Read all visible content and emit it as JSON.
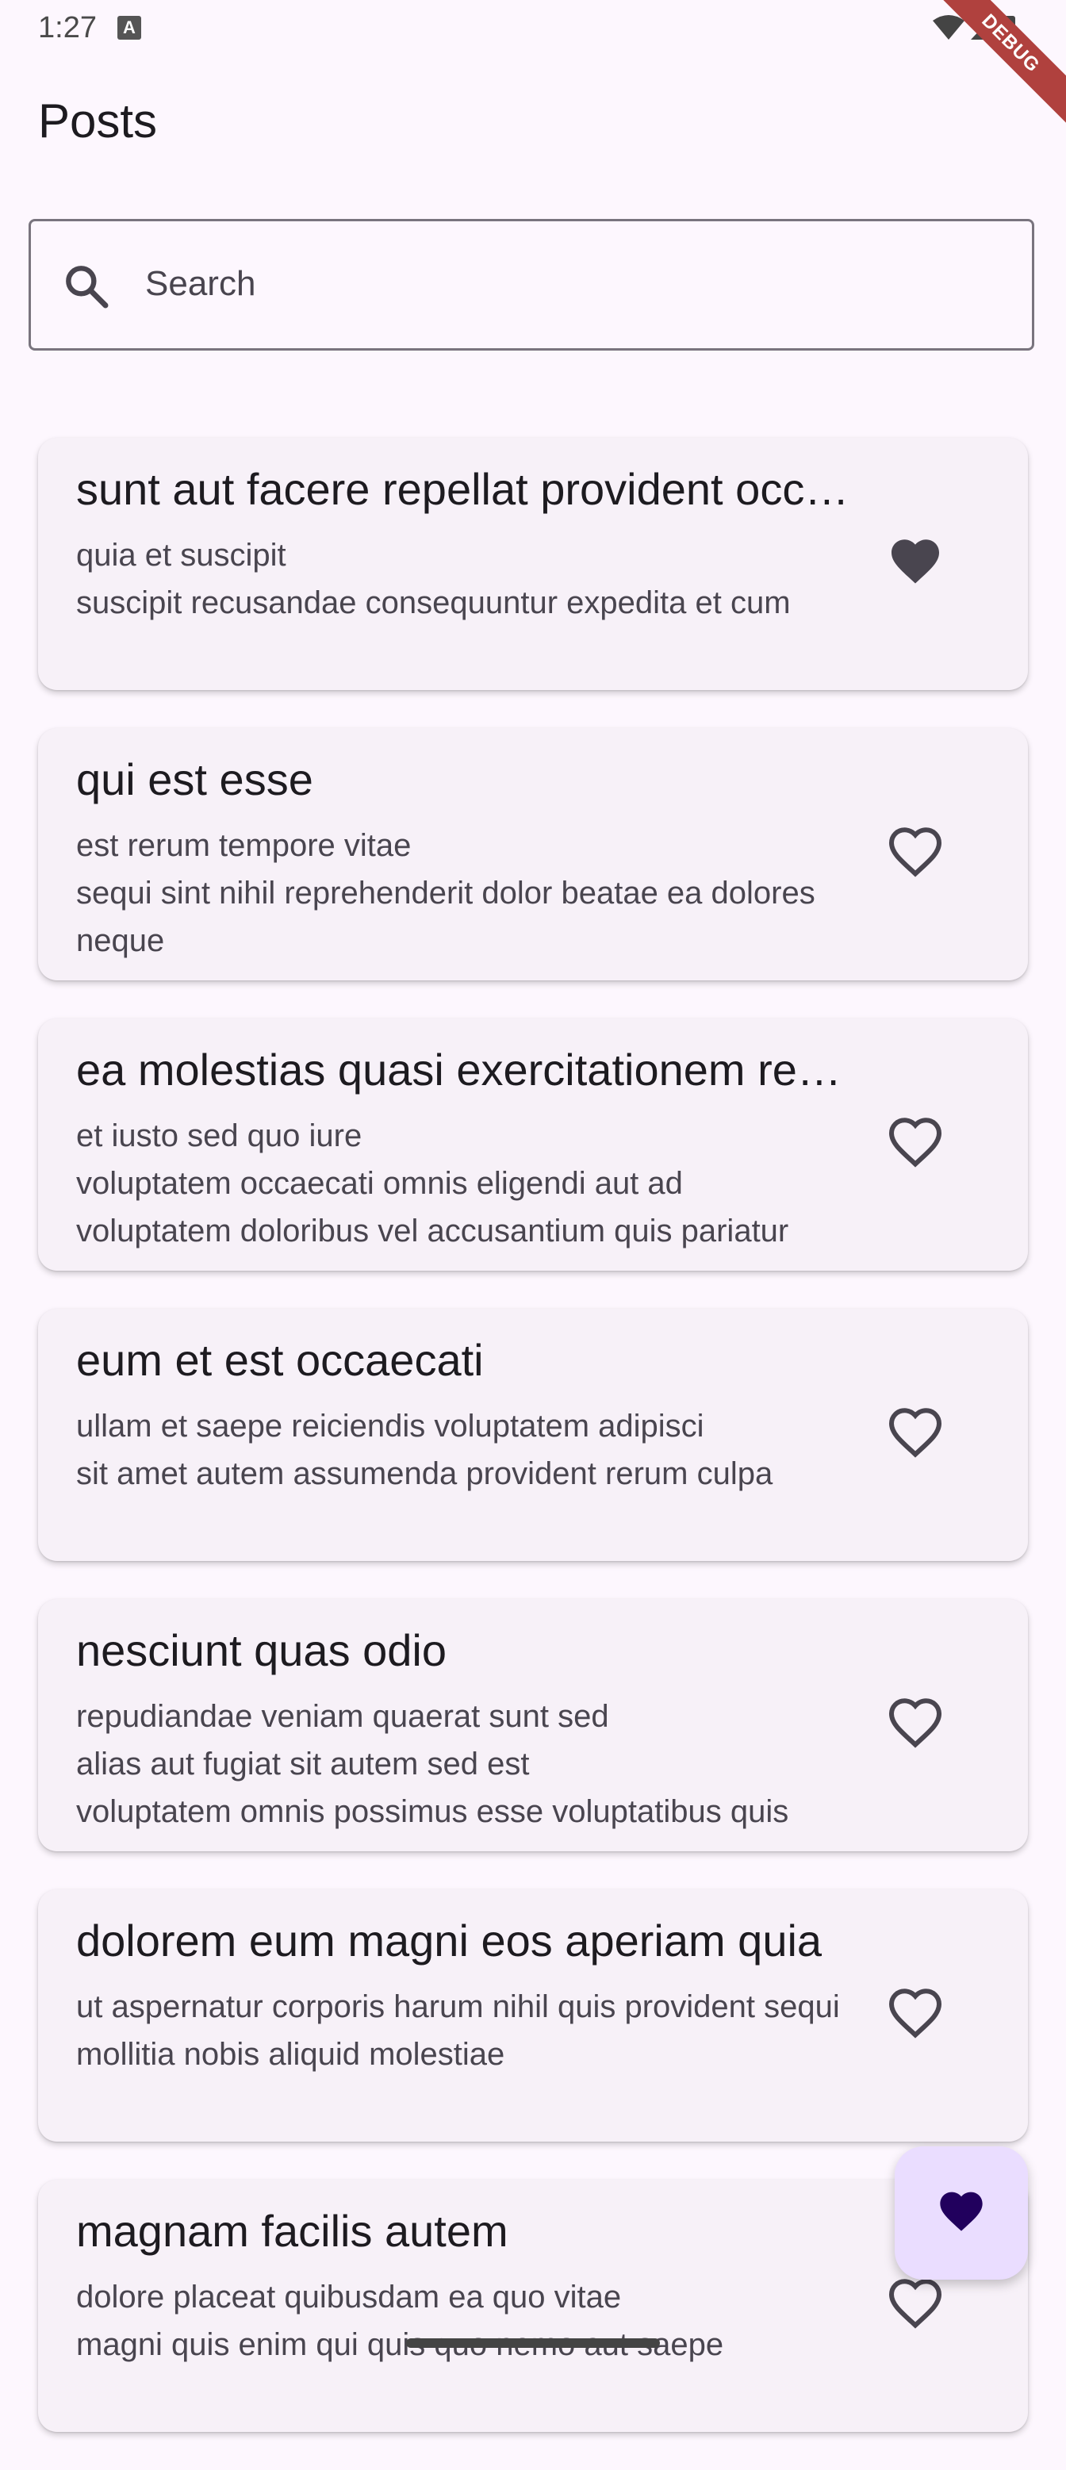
{
  "status_bar": {
    "time": "1:27",
    "notification_letter": "A"
  },
  "debug_banner": {
    "label": "DEBUG"
  },
  "app_bar": {
    "title": "Posts"
  },
  "search": {
    "placeholder": "Search",
    "icon": "search-icon"
  },
  "posts": [
    {
      "title": "sunt aut facere repellat provident occaecati excepturi optio reprehenderit",
      "body": "quia et suscipit\nsuscipit recusandae consequuntur expedita et cum",
      "favorite": true
    },
    {
      "title": "qui est esse",
      "body": "est rerum tempore vitae\nsequi sint nihil reprehenderit dolor beatae ea dolores neque",
      "favorite": false
    },
    {
      "title": "ea molestias quasi exercitationem repellat qui ipsa sit aut",
      "body": "et iusto sed quo iure\nvoluptatem occaecati omnis eligendi aut ad\nvoluptatem doloribus vel accusantium quis pariatur",
      "favorite": false
    },
    {
      "title": "eum et est occaecati",
      "body": "ullam et saepe reiciendis voluptatem adipisci\nsit amet autem assumenda provident rerum culpa",
      "favorite": false
    },
    {
      "title": "nesciunt quas odio",
      "body": "repudiandae veniam quaerat sunt sed\nalias aut fugiat sit autem sed est\nvoluptatem omnis possimus esse voluptatibus quis",
      "favorite": false
    },
    {
      "title": "dolorem eum magni eos aperiam quia",
      "body": "ut aspernatur corporis harum nihil quis provident sequi\nmollitia nobis aliquid molestiae",
      "favorite": false
    },
    {
      "title": "magnam facilis autem",
      "body": "dolore placeat quibusdam ea quo vitae\nmagni quis enim qui quis quo nemo aut saepe",
      "favorite": false
    }
  ],
  "fab": {
    "icon": "heart-icon"
  },
  "colors": {
    "background": "#fdf7fe",
    "card": "#f7f1f8",
    "fab": "#eaddff",
    "fab_icon": "#21005d",
    "heart": "#49454f"
  }
}
